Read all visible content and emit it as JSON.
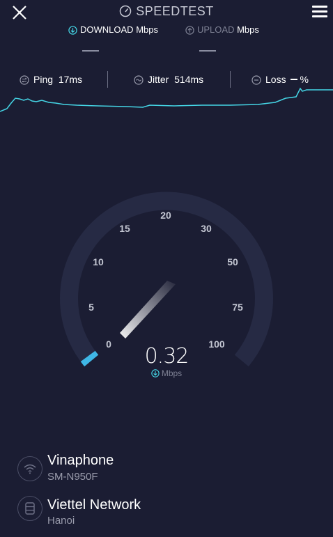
{
  "header": {
    "title": "SPEEDTEST",
    "tabs": {
      "download": {
        "label": "DOWNLOAD",
        "unit": "Mbps"
      },
      "upload": {
        "label": "UPLOAD",
        "unit": "Mbps"
      }
    }
  },
  "metrics": {
    "ping": {
      "label": "Ping",
      "value": "17ms"
    },
    "jitter": {
      "label": "Jitter",
      "value": "514ms"
    },
    "loss": {
      "label": "Loss",
      "unit": "%"
    }
  },
  "gauge": {
    "scale": [
      "0",
      "5",
      "10",
      "15",
      "20",
      "30",
      "50",
      "75",
      "100"
    ],
    "reading": "0.32",
    "unit": "Mbps"
  },
  "connection": {
    "provider": {
      "name": "Vinaphone",
      "device": "SM-N950F"
    },
    "server": {
      "name": "Viettel Network",
      "location": "Hanoi"
    }
  },
  "colors": {
    "background": "#1b1d33",
    "accent": "#45d6e6",
    "gauge_track": "#262a44"
  },
  "icons": [
    "close-icon",
    "speedometer-icon",
    "download-icon",
    "upload-icon",
    "ping-icon",
    "jitter-icon",
    "loss-icon",
    "menu-icon",
    "wifi-icon",
    "server-icon"
  ]
}
